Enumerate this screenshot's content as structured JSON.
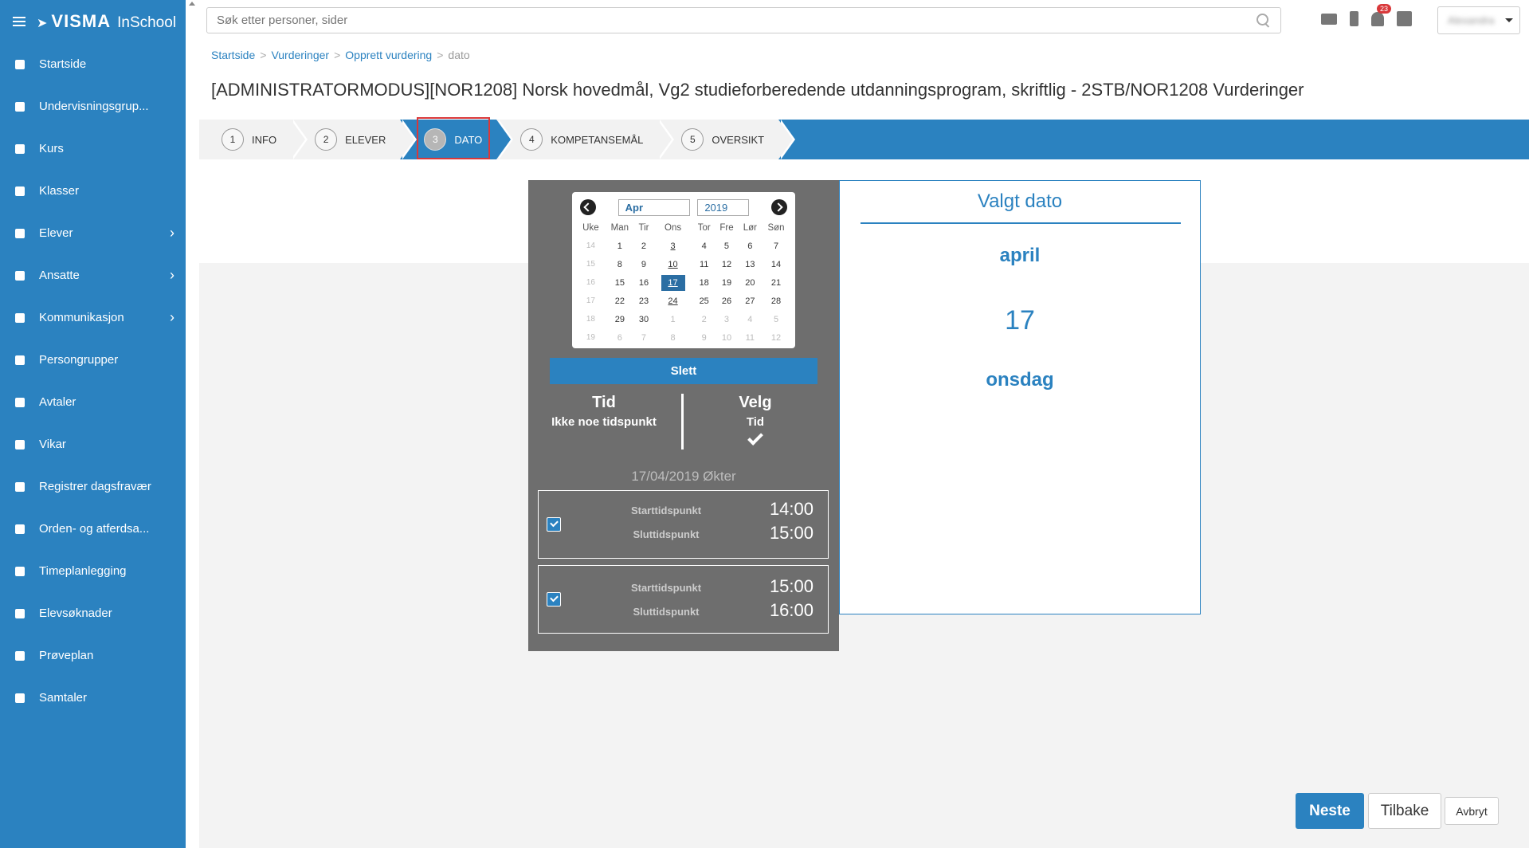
{
  "brand": {
    "logo": "VISMA",
    "product": "InSchool"
  },
  "sidebar": {
    "items": [
      {
        "label": "Startside",
        "icon": "grid-icon",
        "has_chevron": false
      },
      {
        "label": "Undervisningsgrup...",
        "icon": "book-icon",
        "has_chevron": false
      },
      {
        "label": "Kurs",
        "icon": "book-icon",
        "has_chevron": false
      },
      {
        "label": "Klasser",
        "icon": "classroom-icon",
        "has_chevron": false
      },
      {
        "label": "Elever",
        "icon": "students-icon",
        "has_chevron": true
      },
      {
        "label": "Ansatte",
        "icon": "user-icon",
        "has_chevron": true
      },
      {
        "label": "Kommunikasjon",
        "icon": "chat-icon",
        "has_chevron": true
      },
      {
        "label": "Persongrupper",
        "icon": "group-icon",
        "has_chevron": false
      },
      {
        "label": "Avtaler",
        "icon": "calendar-icon",
        "has_chevron": false
      },
      {
        "label": "Vikar",
        "icon": "swap-icon",
        "has_chevron": false
      },
      {
        "label": "Registrer dagsfravær",
        "icon": "pencil-icon",
        "has_chevron": false
      },
      {
        "label": "Orden- og atferdsa...",
        "icon": "hand-icon",
        "has_chevron": false
      },
      {
        "label": "Timeplanlegging",
        "icon": "calendar-icon",
        "has_chevron": false
      },
      {
        "label": "Elevsøknader",
        "icon": "inbox-icon",
        "has_chevron": false
      },
      {
        "label": "Prøveplan",
        "icon": "classroom-icon",
        "has_chevron": false
      },
      {
        "label": "Samtaler",
        "icon": "chat-icon",
        "has_chevron": false
      }
    ]
  },
  "search": {
    "placeholder": "Søk etter personer, sider",
    "value": ""
  },
  "topbar": {
    "notification_count": "23",
    "user_name": "Alexandra"
  },
  "breadcrumb": {
    "items": [
      "Startside",
      "Vurderinger",
      "Opprett vurdering"
    ],
    "current": "dato",
    "separator": ">"
  },
  "page_title": "[ADMINISTRATORMODUS][NOR1208] Norsk hovedmål, Vg2 studieforberedende utdanningsprogram, skriftlig - 2STB/NOR1208 Vurderinger",
  "wizard": {
    "steps": [
      {
        "num": "1",
        "label": "INFO"
      },
      {
        "num": "2",
        "label": "ELEVER"
      },
      {
        "num": "3",
        "label": "DATO"
      },
      {
        "num": "4",
        "label": "KOMPETANSEMÅL"
      },
      {
        "num": "5",
        "label": "OVERSIKT"
      }
    ],
    "active_step": "3"
  },
  "calendar": {
    "month": "Apr",
    "year": "2019",
    "headers": [
      "Uke",
      "Man",
      "Tir",
      "Ons",
      "Tor",
      "Fre",
      "Lør",
      "Søn"
    ],
    "weeks": [
      {
        "week": "14",
        "days": [
          "1",
          "2",
          "3",
          "4",
          "5",
          "6",
          "7"
        ]
      },
      {
        "week": "15",
        "days": [
          "8",
          "9",
          "10",
          "11",
          "12",
          "13",
          "14"
        ]
      },
      {
        "week": "16",
        "days": [
          "15",
          "16",
          "17",
          "18",
          "19",
          "20",
          "21"
        ]
      },
      {
        "week": "17",
        "days": [
          "22",
          "23",
          "24",
          "25",
          "26",
          "27",
          "28"
        ]
      },
      {
        "week": "18",
        "days": [
          "29",
          "30",
          "1",
          "2",
          "3",
          "4",
          "5"
        ]
      },
      {
        "week": "19",
        "days": [
          "6",
          "7",
          "8",
          "9",
          "10",
          "11",
          "12"
        ]
      }
    ],
    "selected_day": "17",
    "underlined_days": [
      "3",
      "10",
      "24"
    ]
  },
  "delete_button": "Slett",
  "time": {
    "left_heading": "Tid",
    "left_sub": "Ikke noe tidspunkt",
    "right_heading": "Velg",
    "right_sub": "Tid"
  },
  "sessions_title": "17/04/2019 Økter",
  "sessions": [
    {
      "start_label": "Starttidspunkt",
      "start": "14:00",
      "end_label": "Sluttidspunkt",
      "end": "15:00",
      "checked": true
    },
    {
      "start_label": "Starttidspunkt",
      "start": "15:00",
      "end_label": "Sluttidspunkt",
      "end": "16:00",
      "checked": true
    }
  ],
  "selected_date": {
    "title": "Valgt dato",
    "month": "april",
    "day": "17",
    "weekday": "onsdag"
  },
  "footer": {
    "next": "Neste",
    "back": "Tilbake",
    "cancel": "Avbryt"
  },
  "colors": {
    "primary": "#2b82c0",
    "panel": "#6e6e6e",
    "highlight": "#d9383a"
  }
}
